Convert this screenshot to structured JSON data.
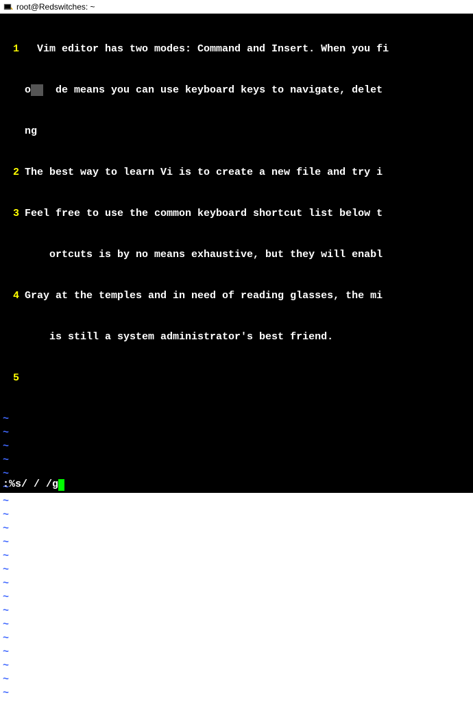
{
  "window": {
    "title": "root@Redswitches: ~"
  },
  "editor": {
    "lines": [
      {
        "number": "1",
        "segments": [
          "  Vim editor has two modes: Command and Insert. When you fi",
          "o   de means you can use keyboard keys to navigate, delet",
          "ng"
        ]
      },
      {
        "number": "2",
        "segments": [
          "The best way to learn Vi is to create a new file and try i"
        ]
      },
      {
        "number": "3",
        "segments": [
          "Feel free to use the common keyboard shortcut list below t",
          "    ortcuts is by no means exhaustive, but they will enabl"
        ]
      },
      {
        "number": "4",
        "segments": [
          "Gray at the temples and in need of reading glasses, the mi",
          "    is still a system administrator's best friend."
        ]
      },
      {
        "number": "5",
        "segments": [
          ""
        ]
      }
    ],
    "tilde": "~",
    "tilde_count": 21
  },
  "command": {
    "text": ":%s/  / /g"
  }
}
